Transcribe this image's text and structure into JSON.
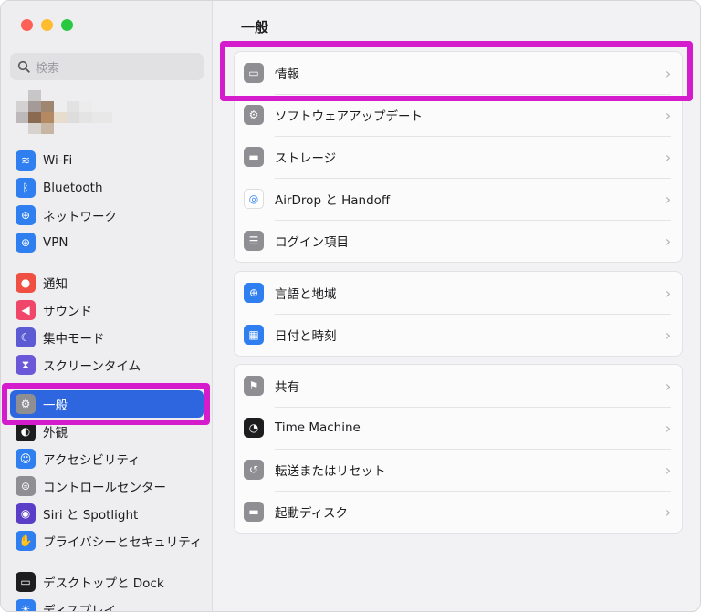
{
  "search": {
    "placeholder": "検索"
  },
  "sidebar": {
    "groups": [
      [
        {
          "label": "Wi-Fi",
          "icon": "wifi-icon",
          "color": "#2f7ff0"
        },
        {
          "label": "Bluetooth",
          "icon": "bluetooth-icon",
          "color": "#2f7ff0"
        },
        {
          "label": "ネットワーク",
          "icon": "globe-icon",
          "color": "#2f7ff0"
        },
        {
          "label": "VPN",
          "icon": "vpn-globe-icon",
          "color": "#2f7ff0"
        }
      ],
      [
        {
          "label": "通知",
          "icon": "bell-icon",
          "color": "#f04f43"
        },
        {
          "label": "サウンド",
          "icon": "speaker-icon",
          "color": "#f0466a"
        },
        {
          "label": "集中モード",
          "icon": "moon-icon",
          "color": "#5c5bd4"
        },
        {
          "label": "スクリーンタイム",
          "icon": "hourglass-icon",
          "color": "#6a58d8"
        }
      ],
      [
        {
          "label": "一般",
          "icon": "gear-icon",
          "color": "#8e8e93",
          "selected": true
        },
        {
          "label": "外観",
          "icon": "appearance-icon",
          "color": "#1d1d1f"
        },
        {
          "label": "アクセシビリティ",
          "icon": "accessibility-icon",
          "color": "#2f7ff0"
        },
        {
          "label": "コントロールセンター",
          "icon": "toggles-icon",
          "color": "#8e8e93"
        },
        {
          "label": "Siri と Spotlight",
          "icon": "siri-icon",
          "color": "#5a3ec8"
        },
        {
          "label": "プライバシーとセキュリティ",
          "icon": "hand-icon",
          "color": "#2f7ff0"
        }
      ],
      [
        {
          "label": "デスクトップと Dock",
          "icon": "dock-icon",
          "color": "#1d1d1f"
        },
        {
          "label": "ディスプレイ",
          "icon": "sun-icon",
          "color": "#2f7ff0"
        }
      ]
    ]
  },
  "main": {
    "title": "一般",
    "cards": [
      [
        {
          "label": "情報",
          "icon": "laptop-icon",
          "color": "#8e8e93"
        },
        {
          "label": "ソフトウェアアップデート",
          "icon": "gear-badge-icon",
          "color": "#8e8e93"
        },
        {
          "label": "ストレージ",
          "icon": "drive-icon",
          "color": "#8e8e93"
        },
        {
          "label": "AirDrop と Handoff",
          "icon": "airdrop-icon",
          "color": "#ffffff"
        },
        {
          "label": "ログイン項目",
          "icon": "list-icon",
          "color": "#8e8e93"
        }
      ],
      [
        {
          "label": "言語と地域",
          "icon": "globe-icon",
          "color": "#2f7ff0"
        },
        {
          "label": "日付と時刻",
          "icon": "calendar-clock-icon",
          "color": "#2f7ff0"
        }
      ],
      [
        {
          "label": "共有",
          "icon": "share-icon",
          "color": "#8e8e93"
        },
        {
          "label": "Time Machine",
          "icon": "time-machine-icon",
          "color": "#1d1d1f"
        },
        {
          "label": "転送またはリセット",
          "icon": "reset-icon",
          "color": "#8e8e93"
        },
        {
          "label": "起動ディスク",
          "icon": "startup-disk-icon",
          "color": "#8e8e93"
        }
      ]
    ]
  },
  "accent": {
    "highlight": "#d41ccc",
    "selection": "#2d66de"
  }
}
